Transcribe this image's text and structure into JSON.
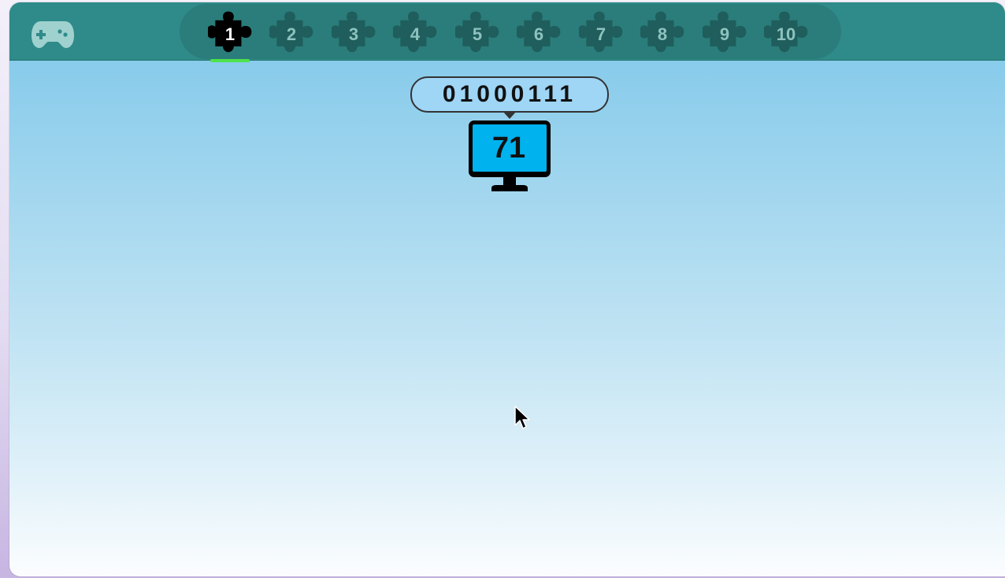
{
  "topbar": {
    "home_icon": "gamepad-icon",
    "levels": [
      {
        "label": "1",
        "active": true
      },
      {
        "label": "2",
        "active": false
      },
      {
        "label": "3",
        "active": false
      },
      {
        "label": "4",
        "active": false
      },
      {
        "label": "5",
        "active": false
      },
      {
        "label": "6",
        "active": false
      },
      {
        "label": "7",
        "active": false
      },
      {
        "label": "8",
        "active": false
      },
      {
        "label": "9",
        "active": false
      },
      {
        "label": "10",
        "active": false
      }
    ],
    "level_icon": "puzzle-piece-icon"
  },
  "puzzle": {
    "binary": "01000111",
    "decimal": "71",
    "monitor_icon": "computer-monitor-icon"
  },
  "colors": {
    "topbar": "#2e8b89",
    "level_bar": "#2a7d7b",
    "active_piece": "#000000",
    "inactive_piece": "#1f5e5c",
    "active_underline": "#4ee24a",
    "monitor_screen": "#00b2ee",
    "bubble": "#9fd5f5"
  }
}
